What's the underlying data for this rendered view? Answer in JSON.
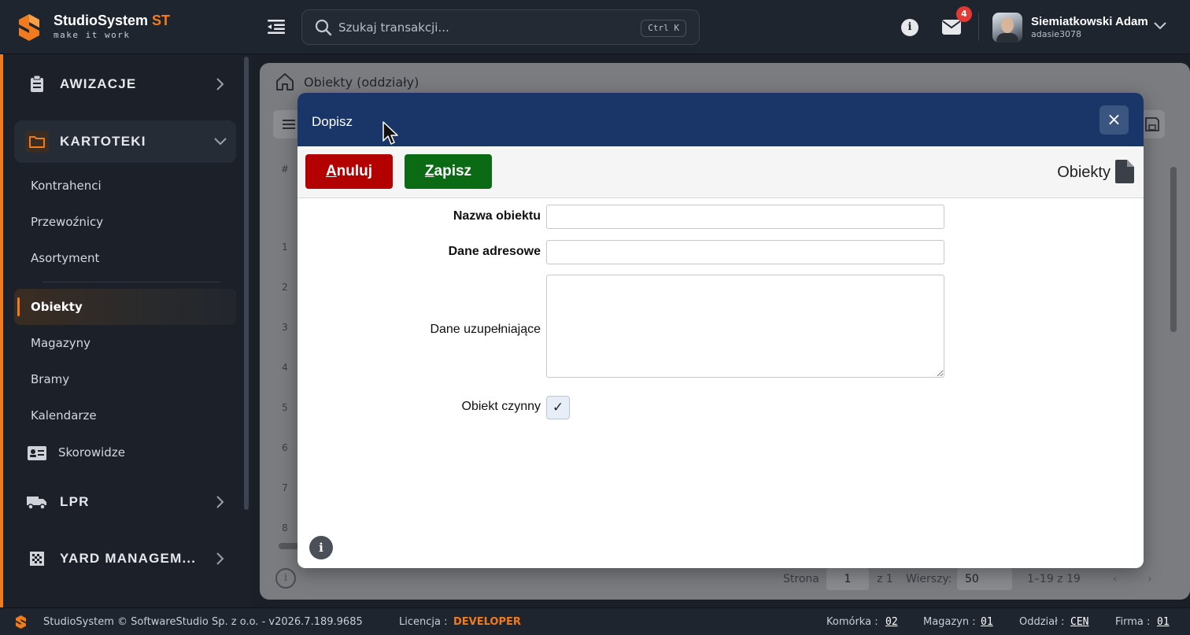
{
  "app": {
    "brand_main": "StudioSystem ",
    "brand_accent": "ST",
    "tagline": "make it work",
    "accent_color": "#f07b1e"
  },
  "header": {
    "search_placeholder": "Szukaj transakcji...",
    "search_shortcut": "Ctrl K",
    "notifications_count": "4",
    "user_name": "Siemiatkowski Adam",
    "user_login": "adasie3078"
  },
  "sidebar": {
    "sections": [
      {
        "label": "AWIZACJE",
        "icon": "clipboard-icon"
      },
      {
        "label": "KARTOTEKI",
        "icon": "folder-icon"
      },
      {
        "label": "LPR",
        "icon": "truck-icon"
      },
      {
        "label": "YARD MANAGEM...",
        "icon": "grid-icon"
      }
    ],
    "items": [
      "Kontrahenci",
      "Przewoźnicy",
      "Asortyment",
      "Obiekty",
      "Magazyny",
      "Bramy",
      "Kalendarze",
      "Skorowidze"
    ],
    "active_item": "Obiekty"
  },
  "background": {
    "breadcrumb": "Obiekty (oddziały)",
    "grid_header_hash": "#",
    "row_numbers": [
      "1",
      "2",
      "3",
      "4",
      "5",
      "6",
      "7",
      "8"
    ],
    "pager": {
      "page_label": "Strona",
      "page_value": "1",
      "of_label": "z 1",
      "rows_label": "Wierszy:",
      "rows_value": "50",
      "range": "1–19  z  19"
    }
  },
  "modal": {
    "title": "Dopisz",
    "close_label": "×",
    "cancel_rest": "nuluj",
    "cancel_key": "A",
    "save_rest": "apisz",
    "save_key": "Z",
    "context_title": "Obiekty",
    "fields": {
      "name_label": "Nazwa obiektu",
      "name_value": "",
      "address_label": "Dane adresowe",
      "address_value": "",
      "extra_label": "Dane uzupełniające",
      "extra_value": "",
      "active_label": "Obiekt czynny",
      "active_mark": "✓"
    },
    "info_icon_label": "i"
  },
  "footer": {
    "copyright": "StudioSystem © SoftwareStudio Sp. z o.o. - v2026.7.189.9685",
    "license_label": "Licencja :",
    "license_value": "DEVELOPER",
    "cell_label": "Komórka :",
    "cell_value": "02",
    "warehouse_label": "Magazyn :",
    "warehouse_value": "01",
    "branch_label": "Oddział :",
    "branch_value": "CEN",
    "company_label": "Firma :",
    "company_value": "01"
  }
}
